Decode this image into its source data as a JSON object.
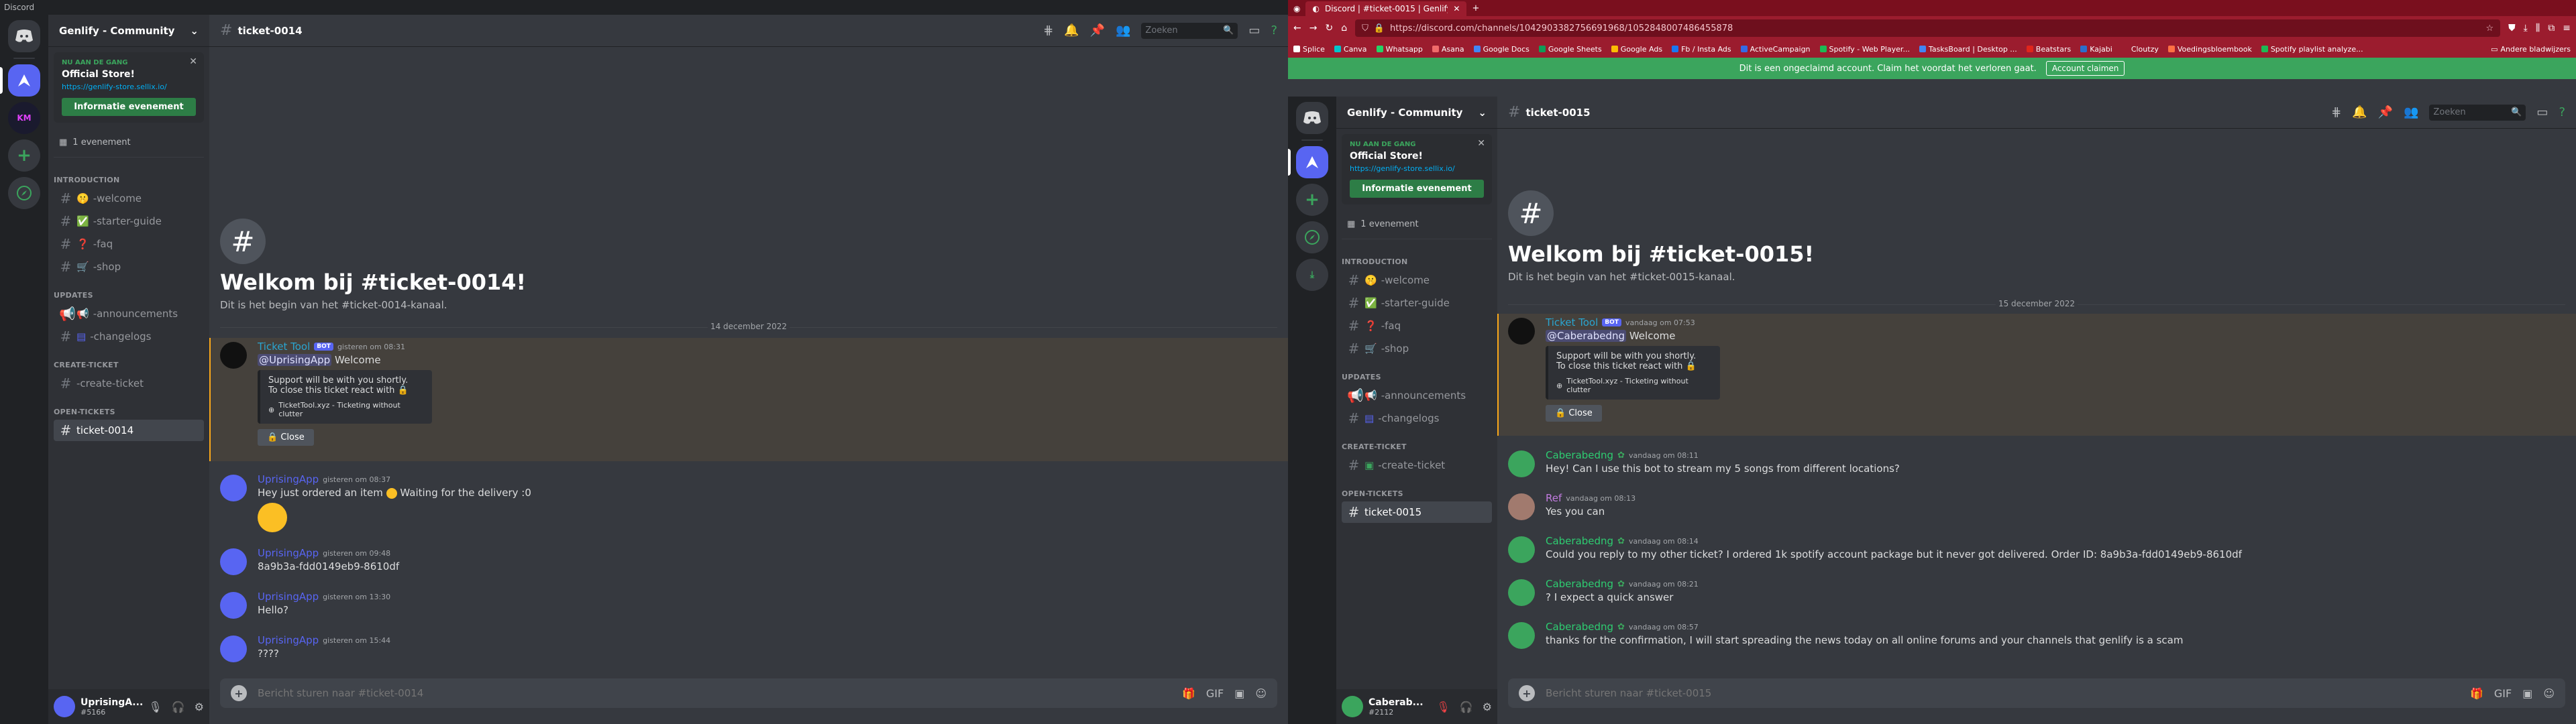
{
  "left": {
    "window_title": "Discord",
    "server_name": "Genlify - Community",
    "event": {
      "tag": "NU AAN DE GANG",
      "title": "Official Store!",
      "link": "https://genlify-store.sellix.io/",
      "button": "Informatie evenement"
    },
    "event_count": "1 evenement",
    "categories": [
      {
        "name": "INTRODUCTION",
        "channels": [
          "-welcome",
          "-starter-guide",
          "-faq",
          "-shop"
        ]
      },
      {
        "name": "UPDATES",
        "channels": [
          "-announcements",
          "-changelogs"
        ]
      },
      {
        "name": "CREATE-TICKET",
        "channels": [
          "-create-ticket"
        ]
      },
      {
        "name": "OPEN-TICKETS",
        "channels": [
          "ticket-0014"
        ]
      }
    ],
    "channel_name": "ticket-0014",
    "search_placeholder": "Zoeken",
    "welcome_title": "Welkom bij #ticket-0014!",
    "welcome_sub": "Dit is het begin van het #ticket-0014-kanaal.",
    "date": "14 december 2022",
    "bot": {
      "name": "Ticket Tool",
      "tag": "BOT",
      "time": "gisteren om 08:31",
      "mention": "@UprisingApp",
      "text": "Welcome",
      "embed_l1": "Support will be with you shortly.",
      "embed_l2": "To close this ticket react with",
      "embed_footer": "TicketTool.xyz - Ticketing without clutter",
      "close": "Close"
    },
    "messages": [
      {
        "name": "UprisingApp",
        "time": "gisteren om 08:37",
        "text": "Hey just ordered an item",
        "text2": "Waiting for the delivery :0"
      },
      {
        "name": "UprisingApp",
        "time": "gisteren om 09:48",
        "text": "8a9b3a-fdd0149eb9-8610df"
      },
      {
        "name": "UprisingApp",
        "time": "gisteren om 13:30",
        "text": "Hello?"
      },
      {
        "name": "UprisingApp",
        "time": "gisteren om 15:44",
        "text": "????"
      }
    ],
    "input_placeholder": "Bericht sturen naar #ticket-0014",
    "user": {
      "name": "UprisingA...",
      "tag": "#5166"
    }
  },
  "right": {
    "tab_title": "Discord | #ticket-0015 | Genlify...",
    "url": "https://discord.com/channels/1042903382756691968/1052848007486455878",
    "bookmarks": [
      "Splice",
      "Canva",
      "Whatsapp",
      "Asana",
      "Google Docs",
      "Google Sheets",
      "Google Ads",
      "Fb / Insta Ads",
      "ActiveCampaign",
      "Spotify - Web Player...",
      "TasksBoard | Desktop ...",
      "Beatstars",
      "Kajabi",
      "Cloutzy",
      "Voedingsbloembook",
      "Spotify playlist analyze..."
    ],
    "other_bookmarks": "Andere bladwijzers",
    "notice": "Dit is een ongeclaimd account. Claim het voordat het verloren gaat.",
    "notice_button": "Account claimen",
    "server_name": "Genlify - Community",
    "event": {
      "tag": "NU AAN DE GANG",
      "title": "Official Store!",
      "link": "https://genlify-store.sellix.io/",
      "button": "Informatie evenement"
    },
    "event_count": "1 evenement",
    "categories": [
      {
        "name": "INTRODUCTION",
        "channels": [
          "-welcome",
          "-starter-guide",
          "-faq",
          "-shop"
        ]
      },
      {
        "name": "UPDATES",
        "channels": [
          "-announcements",
          "-changelogs"
        ]
      },
      {
        "name": "CREATE-TICKET",
        "channels": [
          "-create-ticket"
        ]
      },
      {
        "name": "OPEN-TICKETS",
        "channels": [
          "ticket-0015"
        ]
      }
    ],
    "channel_name": "ticket-0015",
    "search_placeholder": "Zoeken",
    "welcome_title": "Welkom bij #ticket-0015!",
    "welcome_sub": "Dit is het begin van het #ticket-0015-kanaal.",
    "date": "15 december 2022",
    "bot": {
      "name": "Ticket Tool",
      "tag": "BOT",
      "time": "vandaag om 07:53",
      "mention": "@Caberabedng",
      "text": "Welcome",
      "embed_l1": "Support will be with you shortly.",
      "embed_l2": "To close this ticket react with",
      "embed_footer": "TicketTool.xyz - Ticketing without clutter",
      "close": "Close"
    },
    "messages": [
      {
        "name": "Caberabedng",
        "time": "vandaag om 08:11",
        "text": "Hey! Can I use this bot to stream my 5 songs from different locations?"
      },
      {
        "name": "Ref",
        "time": "vandaag om 08:13",
        "text": "Yes you can"
      },
      {
        "name": "Caberabedng",
        "time": "vandaag om 08:14",
        "text": "Could you reply to my other ticket? I ordered 1k spotify account package but it never got delivered. Order ID: 8a9b3a-fdd0149eb9-8610df"
      },
      {
        "name": "Caberabedng",
        "time": "vandaag om 08:21",
        "text": "? I expect a quick answer"
      },
      {
        "name": "Caberabedng",
        "time": "vandaag om 08:57",
        "text": "thanks for the confirmation, I will start spreading the news today on all online forums and your channels that genlify is a scam"
      }
    ],
    "input_placeholder": "Bericht sturen naar #ticket-0015",
    "user": {
      "name": "Caberab...",
      "tag": "#2112"
    }
  }
}
